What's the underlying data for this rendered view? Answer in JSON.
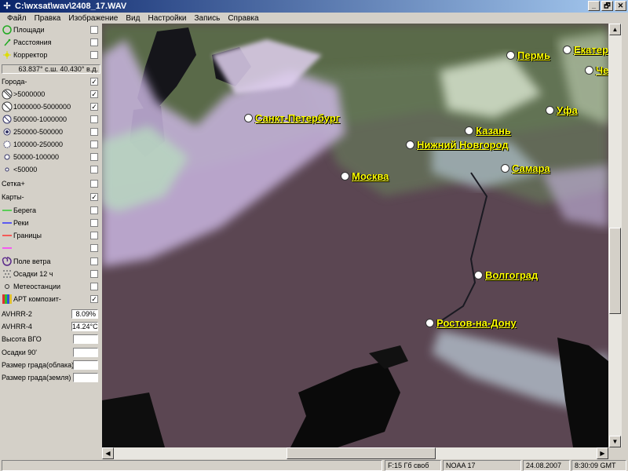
{
  "window": {
    "title": "C:\\wxsat\\wav\\2408_17.WAV",
    "buttons": [
      "_",
      "🗗",
      "✕"
    ]
  },
  "menu": [
    "Файл",
    "Правка",
    "Изображение",
    "Вид",
    "Настройки",
    "Запись",
    "Справка"
  ],
  "panel": {
    "tools": [
      {
        "label": "Площади",
        "icon": "circle-outline-icon",
        "checked": false
      },
      {
        "label": "Расстояния",
        "icon": "ruler-icon",
        "checked": false
      },
      {
        "label": "Корректор",
        "icon": "star-icon",
        "checked": false
      }
    ],
    "coords": "63.837° с.ш.  40.430° в.д.",
    "cities_header": {
      "label": "Города-",
      "checked": true
    },
    "cities": [
      {
        "label": ">5000000",
        "checked": true
      },
      {
        "label": "1000000-5000000",
        "checked": true
      },
      {
        "label": "500000-1000000",
        "checked": false
      },
      {
        "label": "250000-500000",
        "checked": false
      },
      {
        "label": "100000-250000",
        "checked": false
      },
      {
        "label": "50000-100000",
        "checked": false
      },
      {
        "label": "<50000",
        "checked": false
      }
    ],
    "grid": {
      "label": "Сетка+",
      "checked": false
    },
    "maps_header": {
      "label": "Карты-",
      "checked": true
    },
    "maps": [
      {
        "label": "Берега",
        "color": "#33cc33",
        "checked": false
      },
      {
        "label": "Реки",
        "color": "#3333ff",
        "checked": false
      },
      {
        "label": "Границы",
        "color": "#ff3333",
        "checked": false
      },
      {
        "label": "",
        "color": "#ff33ff",
        "checked": false
      }
    ],
    "layers": [
      {
        "label": "Поле ветра",
        "icon": "wind-icon",
        "checked": false
      },
      {
        "label": "Осадки 12 ч",
        "icon": "precip-icon",
        "checked": false
      },
      {
        "label": "Метеостанции",
        "icon": "station-icon",
        "checked": false
      },
      {
        "label": "АРТ композит-",
        "icon": "composite-icon",
        "checked": true
      }
    ],
    "values": [
      {
        "label": "AVHRR-2",
        "value": "8.09%"
      },
      {
        "label": "AVHRR-4",
        "value": "14.24°C"
      },
      {
        "label": "Высота ВГО",
        "value": ""
      },
      {
        "label": "Осадки 90'",
        "value": ""
      },
      {
        "label": "Размер града(облака)",
        "value": ""
      },
      {
        "label": "Размер града(земля)",
        "value": ""
      }
    ]
  },
  "map_cities": [
    {
      "name": "Санкт-Петербург"
    },
    {
      "name": "Москва"
    },
    {
      "name": "Нижний Новгород"
    },
    {
      "name": "Казань"
    },
    {
      "name": "Самара"
    },
    {
      "name": "Уфа"
    },
    {
      "name": "Пермь"
    },
    {
      "name": "Екатери"
    },
    {
      "name": "Челя"
    },
    {
      "name": "Волгоград"
    },
    {
      "name": "Ростов-на-Дону"
    }
  ],
  "status": {
    "disk": "F:15 Гб своб",
    "satellite": "NOAA 17",
    "date": "24.08.2007",
    "time": "8:30:09 GMT"
  }
}
